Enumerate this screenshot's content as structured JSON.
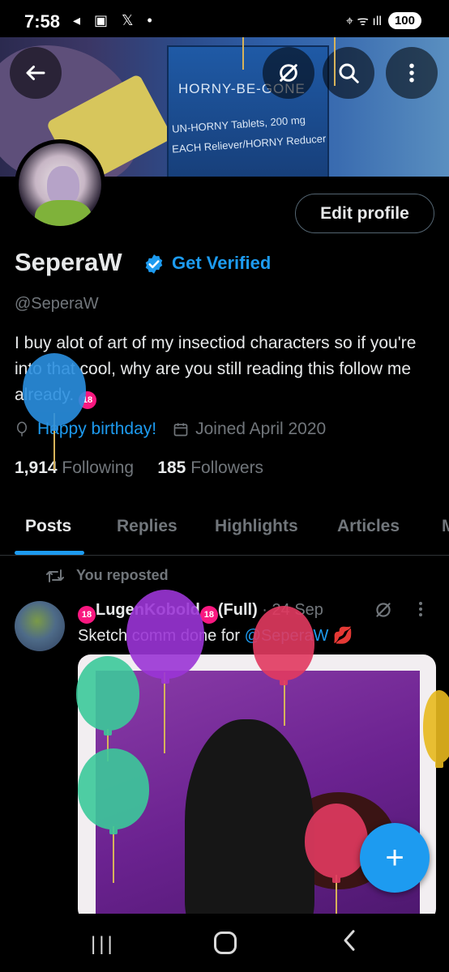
{
  "status_bar": {
    "time": "7:58",
    "left_icons": "◂ ▣ 𝕏 •",
    "signal": "⌖ ᯤ ıll",
    "battery": "100"
  },
  "banner": {
    "line1": "HORNY-BE-GONE",
    "line2": "UN-HORNY Tablets, 200 mg",
    "line3": "EACH Reliever/HORNY Reducer"
  },
  "profile": {
    "edit_button": "Edit profile",
    "name": "SeperaW",
    "get_verified": "Get Verified",
    "handle": "@SeperaW",
    "bio": "I buy alot of art of my insectiod characters so if you're into that cool, why are you still reading this follow me already.",
    "bio_badge": "18",
    "birthday": "Happy birthday!",
    "joined": "Joined April 2020",
    "following_count": "1,914",
    "following_label": "Following",
    "followers_count": "185",
    "followers_label": "Followers"
  },
  "tabs": [
    "Posts",
    "Replies",
    "Highlights",
    "Articles",
    "M"
  ],
  "post": {
    "repost_label": "You reposted",
    "author": "LugenKobold",
    "author_suffix": "(Full)",
    "badge": "18",
    "date": "· 24 Sep",
    "text_prefix": "Sketch comm done for ",
    "mention": "@SeperaW",
    "lips": "💋"
  },
  "fab_label": "+",
  "colors": {
    "accent": "#1d9bf0",
    "muted": "#71767b",
    "text": "#e7e9ea",
    "background": "#000000"
  }
}
